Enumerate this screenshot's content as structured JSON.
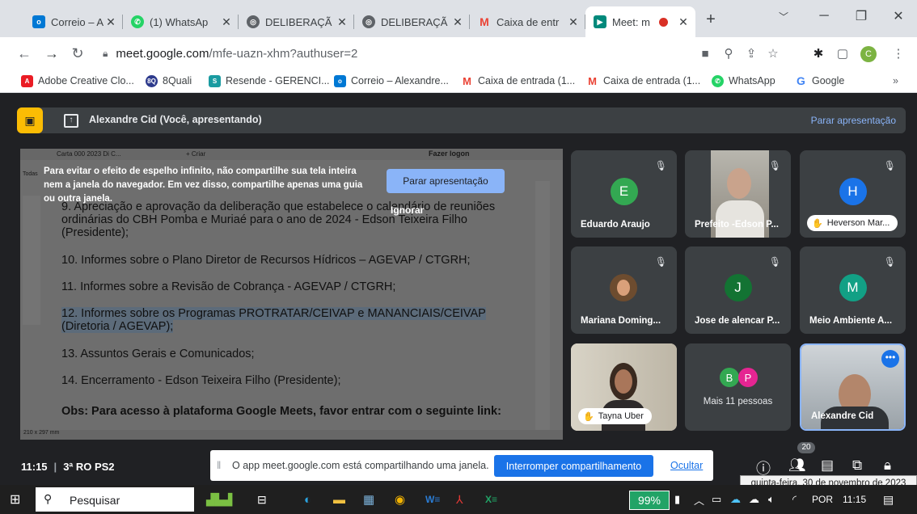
{
  "browser": {
    "tabs": [
      {
        "title": "Correio – Ale",
        "icon": "outlook-icon",
        "color": "#0078d4"
      },
      {
        "title": "(1) WhatsAp",
        "icon": "whatsapp-icon",
        "color": "#25d366"
      },
      {
        "title": "DELIBERAÇÃ",
        "icon": "globe-icon",
        "color": "#5f6368"
      },
      {
        "title": "DELIBERAÇÃ",
        "icon": "globe-icon",
        "color": "#5f6368"
      },
      {
        "title": "Caixa de entr",
        "icon": "gmail-icon",
        "color": "#ea4335"
      },
      {
        "title": "Meet: m",
        "icon": "meet-icon",
        "color": "#00897b",
        "active": true
      }
    ],
    "url_host": "meet.google.com",
    "url_path": "/mfe-uazn-xhm?authuser=2",
    "profile_letter": "C",
    "bookmarks": [
      {
        "label": "Adobe Creative Clo...",
        "icon": "adobe-icon",
        "color": "#ea1c24"
      },
      {
        "label": "8Quali",
        "icon": "8q-icon",
        "color": "#2d3a8c"
      },
      {
        "label": "Resende - GERENCI...",
        "icon": "sharepoint-icon",
        "color": "#1a9ba1"
      },
      {
        "label": "Correio – Alexandre...",
        "icon": "outlook-icon",
        "color": "#0078d4"
      },
      {
        "label": "Caixa de entrada (1...",
        "icon": "gmail-icon",
        "color": "#ea4335"
      },
      {
        "label": "Caixa de entrada (1...",
        "icon": "gmail-icon",
        "color": "#ea4335"
      },
      {
        "label": "WhatsApp",
        "icon": "whatsapp-icon",
        "color": "#25d366"
      },
      {
        "label": "Google",
        "icon": "google-icon",
        "color": "#4285f4"
      }
    ],
    "bookmarks_more": "»"
  },
  "meet": {
    "presenter_text": "Alexandre Cid (Você, apresentando)",
    "stop_presenting": "Parar apresentação",
    "shared_screen": {
      "mini_tab": "Carta 000 2023 Di C...",
      "mini_tab_new": "+ Criar",
      "mini_login": "Fazer logon",
      "mini_side": "Todas",
      "warning": "Para evitar o efeito de espelho infinito, não compartilhe sua tela inteira nem a janela do navegador. Em vez disso, compartilhe apenas uma guia ou outra janela.",
      "warning_stop": "Parar apresentação",
      "warning_ignore": "Ignorar",
      "lines": [
        "9. Apreciação e aprovação da deliberação que estabelece o calendário de reuniões",
        "ordinárias do CBH Pomba e Muriaé  para o ano de 2024 - Edson Teixeira Filho",
        "(Presidente);",
        "10. Informes sobre o Plano Diretor de Recursos Hídricos – AGEVAP / CTGRH;",
        "11. Informes sobre a Revisão de Cobrança - AGEVAP / CTGRH;",
        "12. Informes sobre os Programas PROTRATAR/CEIVAP e MANANCIAIS/CEIVAP",
        "(Diretoria / AGEVAP);",
        "13. Assuntos Gerais e Comunicados;",
        "14. Encerramento - Edson Teixeira Filho (Presidente);",
        "Obs: Para acesso à plataforma Google Meets, favor entrar com o seguinte link:"
      ],
      "page_size": "210 x 297 mm"
    },
    "participants": [
      {
        "name": "Eduardo Araujo",
        "initial": "E",
        "color": "#33a852",
        "muted": true
      },
      {
        "name": "Prefeito -Edson P...",
        "initial": "",
        "color": "",
        "muted": true,
        "video": true
      },
      {
        "name": "Heverson Mar...",
        "initial": "H",
        "color": "#1a73e8",
        "muted": true,
        "pill": true
      },
      {
        "name": "Mariana Doming...",
        "initial": "",
        "color": "",
        "muted": true,
        "photo": true
      },
      {
        "name": "Jose de alencar P...",
        "initial": "J",
        "color": "#137333",
        "muted": true
      },
      {
        "name": "Meio Ambiente A...",
        "initial": "M",
        "color": "#12a085",
        "muted": true
      },
      {
        "name": "Tayna Uber",
        "initial": "",
        "color": "",
        "muted": false,
        "video": true,
        "pill": true
      },
      {
        "name": "Mais 11 pessoas",
        "initial": "",
        "color": "",
        "muted": false,
        "others": [
          "B",
          "P"
        ]
      },
      {
        "name": "Alexandre Cid",
        "initial": "",
        "color": "",
        "muted": false,
        "video": true,
        "self": true
      }
    ],
    "time": "11:15",
    "meeting_name": "3ª RO PS2",
    "share_notice": "O app meet.google.com está compartilhando uma janela.",
    "stop_sharing": "Interromper compartilhamento",
    "hide": "Ocultar",
    "people_count": "20",
    "tooltip_date": "quinta-feira, 30 de novembro de 2023"
  },
  "taskbar": {
    "search": "Pesquisar",
    "battery": "99%",
    "lang": "POR",
    "clock": "11:15"
  }
}
